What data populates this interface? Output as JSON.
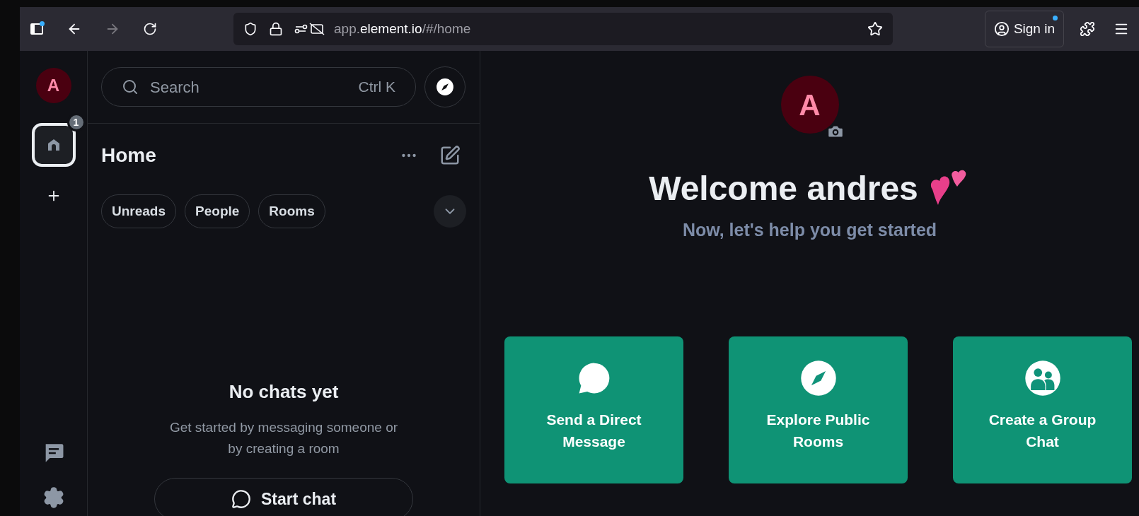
{
  "browser": {
    "url_host": "app.",
    "url_domain": "element.io",
    "url_path": "/#/home",
    "sign_in": "Sign in"
  },
  "rail": {
    "avatar_letter": "A",
    "home_badge": "1",
    "home_selected": true
  },
  "sidebar": {
    "search": {
      "placeholder": "Search",
      "shortcut": "Ctrl K"
    },
    "title": "Home",
    "filters": [
      {
        "label": "Unreads",
        "selected": false
      },
      {
        "label": "People",
        "selected": false
      },
      {
        "label": "Rooms",
        "selected": false
      }
    ],
    "empty_title": "No chats yet",
    "empty_text": "Get started by messaging someone or by creating a room",
    "start_chat": "Start chat"
  },
  "main": {
    "avatar_letter": "A",
    "welcome": "Welcome andres",
    "subtitle": "Now, let's help you get started",
    "cards": [
      {
        "kind": "message",
        "label": "Send a Direct Message"
      },
      {
        "kind": "explore",
        "label": "Explore Public Rooms"
      },
      {
        "kind": "group",
        "label": "Create a Group Chat"
      }
    ]
  }
}
